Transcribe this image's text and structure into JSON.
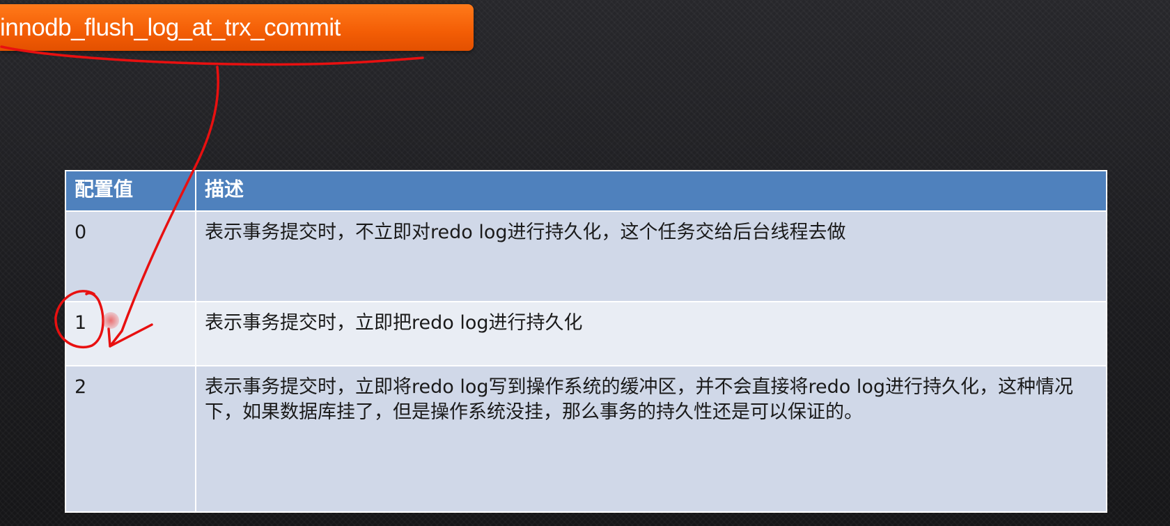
{
  "slide": {
    "title": "innodb_flush_log_at_trx_commit"
  },
  "table": {
    "headers": {
      "value": "配置值",
      "description": "描述"
    },
    "rows": [
      {
        "value": "0",
        "description": "表示事务提交时，不立即对redo log进行持久化，这个任务交给后台线程去做"
      },
      {
        "value": "1",
        "description": "表示事务提交时，立即把redo log进行持久化"
      },
      {
        "value": "2",
        "description": "表示事务提交时，立即将redo log写到操作系统的缓冲区，并不会直接将redo log进行持久化，这种情况下，如果数据库挂了，但是操作系统没挂，那么事务的持久性还是可以保证的。"
      }
    ]
  },
  "colors": {
    "banner": "#f35d05",
    "header": "#4f81bd",
    "row_dark": "#d0d8e8",
    "row_light": "#e9edf4",
    "annotation": "#e81010"
  },
  "annotations": [
    "red-underline-stroke",
    "red-arrow-stroke",
    "red-circle-stroke",
    "red-cursor-dot"
  ]
}
